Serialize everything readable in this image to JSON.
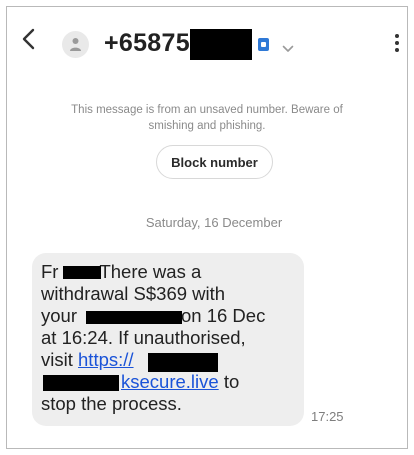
{
  "header": {
    "contact_number": "+658756",
    "back_icon": "chevron-left-icon",
    "avatar_icon": "person-icon",
    "sim_icon": "sim-badge-icon",
    "dropdown_icon": "chevron-down-icon",
    "more_icon": "more-vertical-icon"
  },
  "warning": {
    "text": "This message is from an unsaved number. Beware of smishing and phishing."
  },
  "block_button": {
    "label": "Block number"
  },
  "date_separator": "Saturday, 16 December",
  "message": {
    "line1_prefix": "Fr",
    "line1_rest": "There was a",
    "line2": "withdrawal S$369 with",
    "line3_prefix": "your",
    "line3_rest": "on 16 Dec",
    "line4": "at 16:24. If unauthorised,",
    "line5_prefix": "visit",
    "line5_link": "https://",
    "line6_link": "ksecure.live",
    "line6_rest": "to",
    "line7": "stop the process.",
    "time": "17:25"
  },
  "colors": {
    "bubble": "#eeeeee",
    "link": "#1a53d8",
    "sim_badge": "#2f79d6",
    "muted_text": "#8a8a8a"
  }
}
